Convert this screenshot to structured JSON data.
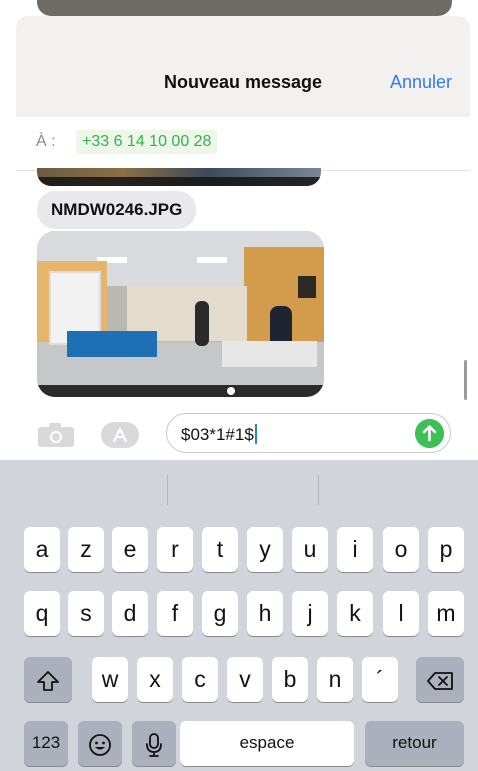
{
  "header": {
    "title": "Nouveau message",
    "cancel_label": "Annuler"
  },
  "recipient": {
    "label": "À :",
    "value": "+33 6 14 10 00 28"
  },
  "conversation": {
    "attachment_name": "NMDW0246.JPG"
  },
  "composer": {
    "text": "$03*1#1$"
  },
  "keyboard": {
    "row1": [
      "a",
      "z",
      "e",
      "r",
      "t",
      "y",
      "u",
      "i",
      "o",
      "p"
    ],
    "row2": [
      "q",
      "s",
      "d",
      "f",
      "g",
      "h",
      "j",
      "k",
      "l",
      "m"
    ],
    "row3": [
      "w",
      "x",
      "c",
      "v",
      "b",
      "n",
      "´"
    ],
    "numbers_label": "123",
    "space_label": "espace",
    "return_label": "retour"
  },
  "colors": {
    "accent_blue": "#2f7fe0",
    "recipient_green": "#34b24a",
    "send_green": "#3cbf54"
  }
}
